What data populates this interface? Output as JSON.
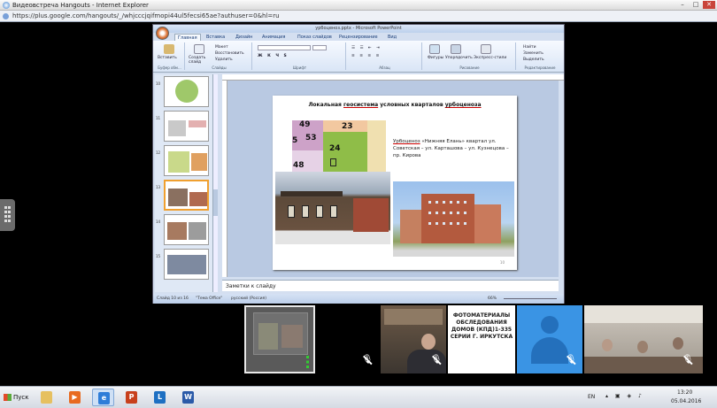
{
  "browser": {
    "title": "Видеовстреча Hangouts - Internet Explorer",
    "url": "https://plus.google.com/hangouts/_/whjcccjqifmopi44ul5fecsi65ae?authuser=0&hl=ru",
    "window_controls": {
      "minimize": "–",
      "maximize": "□",
      "close": "✕"
    }
  },
  "powerpoint": {
    "title": "урбоценоз.pptx - Microsoft PowerPoint",
    "tabs": [
      "Главная",
      "Вставка",
      "Дизайн",
      "Анимация",
      "Показ слайдов",
      "Рецензирование",
      "Вид"
    ],
    "active_tab": "Главная",
    "ribbon": {
      "paste": "Вставить",
      "create_slide": "Создать слайд",
      "layout": "Макет",
      "reset": "Восстановить",
      "delete": "Удалить",
      "shapes": "Фигуры",
      "arrange": "Упорядочить",
      "quick_styles": "Экспресс-стили",
      "find": "Найти",
      "replace": "Заменить",
      "select": "Выделить",
      "group_clipboard": "Буфер обм...",
      "group_slides": "Слайды",
      "group_font": "Шрифт",
      "group_paragraph": "Абзац",
      "group_drawing": "Рисование",
      "group_editing": "Редактирование"
    },
    "thumb_numbers": [
      "10",
      "11",
      "12",
      "13",
      "14",
      "15"
    ],
    "slide": {
      "title_prefix": "Локальная",
      "title_link1": "геосистема",
      "title_middle": "условных кварталов",
      "title_link2": "урбоценоза",
      "text_link": "Урбоценоз",
      "text_rest": "«Нижняя Елань» квартал ул. Советская – ул. Карташова – ул. Кузнецова – пр. Кирова",
      "map_labels": [
        "49",
        "23",
        "5",
        "53",
        "24",
        "48"
      ],
      "number": "10"
    },
    "notes_placeholder": "Заметки к слайду",
    "status": {
      "slide_of": "Слайд 10 из 16",
      "theme": "\"Тема Office\"",
      "language": "русский (Россия)",
      "zoom": "66%"
    }
  },
  "participants": {
    "doc_card_text": "ФОТОМАТЕРИАЛЫ ОБСЛЕДОВАНИЯ ДОМОВ (КПД)1-335 СЕРИИ Г. ИРКУТСКА"
  },
  "taskbar": {
    "start_label": "Пуск",
    "apps": [
      "explorer",
      "media-player",
      "internet-explorer",
      "powerpoint",
      "lync",
      "word"
    ],
    "language": "EN",
    "time": "13:20",
    "date": "05.04.2016"
  },
  "colors": {
    "accent_blue": "#3a94e4",
    "office_orange": "#e07a3c",
    "link_underline": "#cc0000"
  }
}
